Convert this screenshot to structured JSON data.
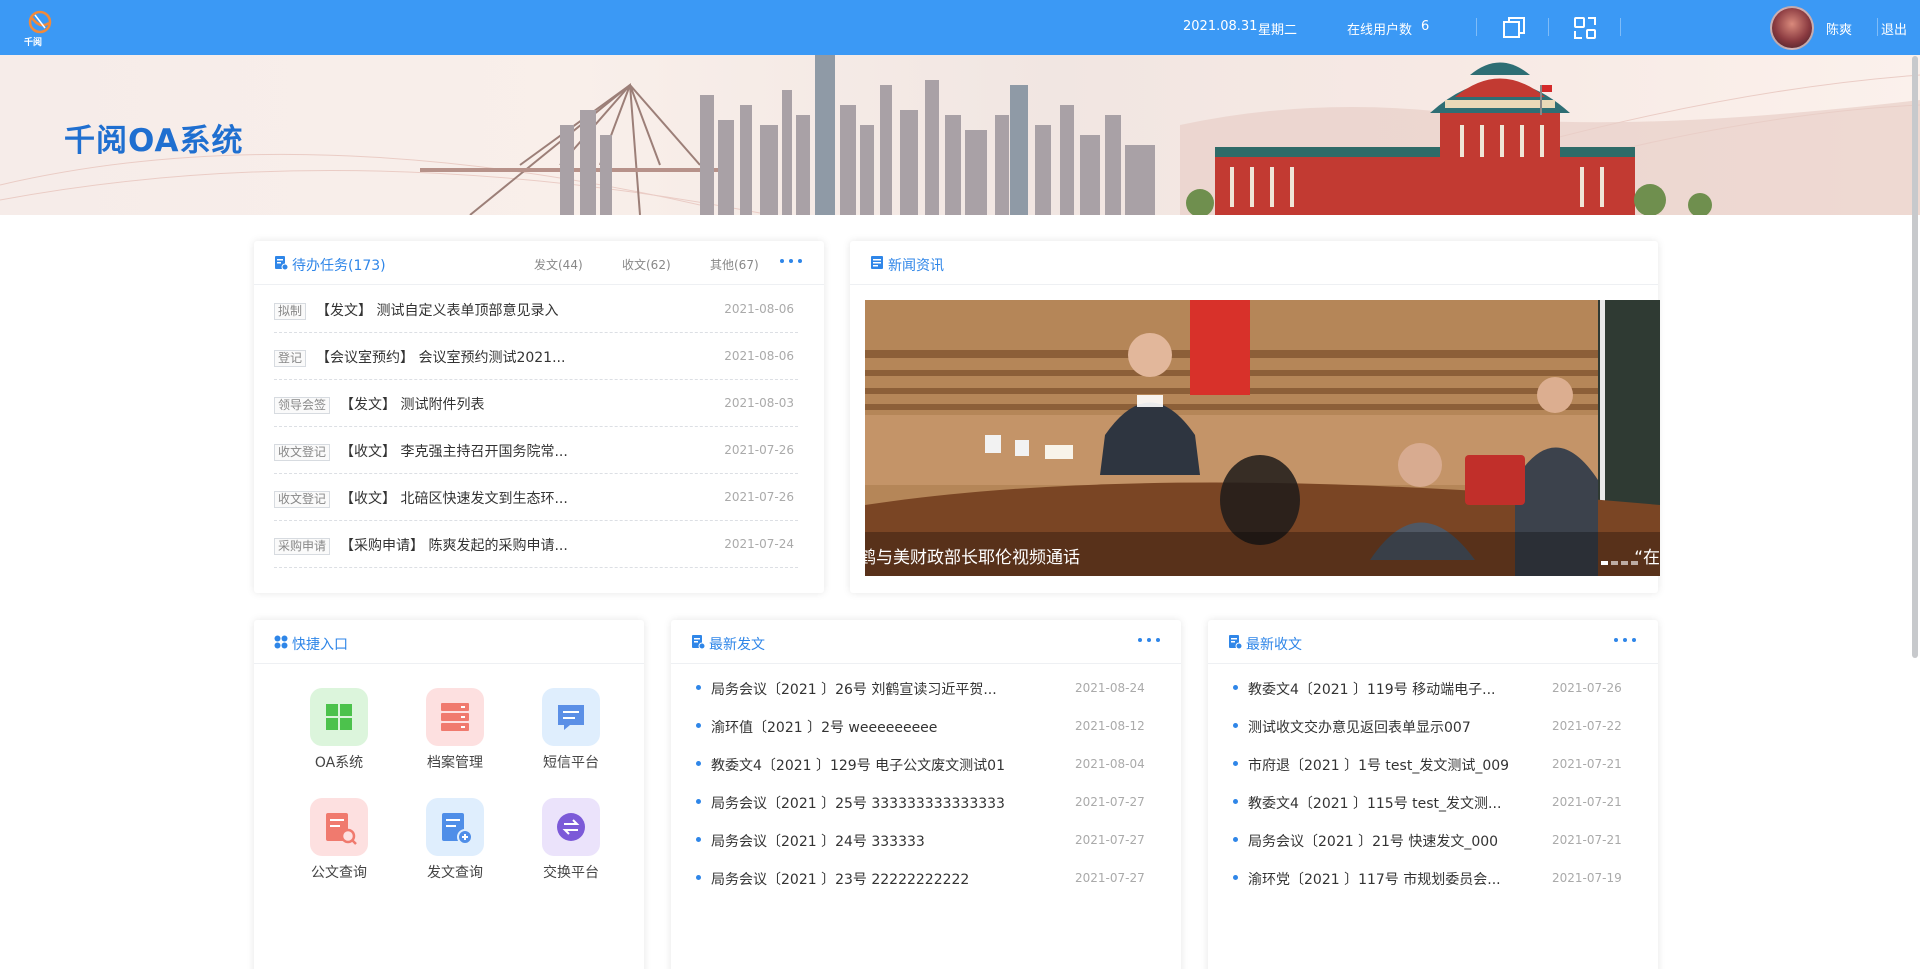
{
  "header": {
    "logo_text": "千阅",
    "date": "2021.08.31",
    "weekday": "星期二",
    "online_label": "在线用户数",
    "online_count": "6",
    "username": "陈爽",
    "logout": "退出",
    "accent": "#3b99f5"
  },
  "banner": {
    "title": "千阅OA系统"
  },
  "todo": {
    "title": "待办任务(173)",
    "filters": [
      "发文(44)",
      "收文(62)",
      "其他(67)"
    ],
    "items": [
      {
        "tag": "拟制",
        "text": "【发文】 测试自定义表单顶部意见录入",
        "date": "2021-08-06"
      },
      {
        "tag": "登记",
        "text": "【会议室预约】 会议室预约测试2021...",
        "date": "2021-08-06"
      },
      {
        "tag": "领导会签",
        "text": "【发文】 测试附件列表",
        "date": "2021-08-03"
      },
      {
        "tag": "收文登记",
        "text": "【收文】 李克强主持召开国务院常...",
        "date": "2021-07-26"
      },
      {
        "tag": "收文登记",
        "text": "【收文】 北碚区快速发文到生态环...",
        "date": "2021-07-26"
      },
      {
        "tag": "采购申请",
        "text": "【采购申请】 陈爽发起的采购申请...",
        "date": "2021-07-24"
      }
    ]
  },
  "news": {
    "title": "新闻资讯",
    "caption": "鹤与美财政部长耶伦视频通话",
    "caption_next": "“在"
  },
  "shortcuts": {
    "title": "快捷入口",
    "items": [
      {
        "label": "OA系统",
        "icon": "windows-icon",
        "bg": "#dcf5dc",
        "fg": "#4cc24c"
      },
      {
        "label": "档案管理",
        "icon": "archive-icon",
        "bg": "#fde0e0",
        "fg": "#f07a6e"
      },
      {
        "label": "短信平台",
        "icon": "sms-icon",
        "bg": "#dfeefd",
        "fg": "#5b8fe6"
      },
      {
        "label": "公文查询",
        "icon": "doc-search-icon",
        "bg": "#fde0e0",
        "fg": "#f07a6e"
      },
      {
        "label": "发文查询",
        "icon": "send-doc-icon",
        "bg": "#dfeefd",
        "fg": "#4f8ee8"
      },
      {
        "label": "交换平台",
        "icon": "exchange-icon",
        "bg": "#ebe3fb",
        "fg": "#7c5ad8"
      }
    ]
  },
  "sent": {
    "title": "最新发文",
    "items": [
      {
        "text": "局务会议〔2021 〕26号 刘鹤宣读习近平贺...",
        "date": "2021-08-24"
      },
      {
        "text": "渝环值〔2021 〕2号 weeeeeeeee",
        "date": "2021-08-12"
      },
      {
        "text": "教委文4〔2021 〕129号 电子公文废文测试01",
        "date": "2021-08-04"
      },
      {
        "text": "局务会议〔2021 〕25号 333333333333333",
        "date": "2021-07-27"
      },
      {
        "text": "局务会议〔2021 〕24号 333333",
        "date": "2021-07-27"
      },
      {
        "text": "局务会议〔2021 〕23号 22222222222",
        "date": "2021-07-27"
      }
    ]
  },
  "received": {
    "title": "最新收文",
    "items": [
      {
        "text": "教委文4〔2021 〕119号 移动端电子...",
        "date": "2021-07-26"
      },
      {
        "text": "测试收文交办意见返回表单显示007",
        "date": "2021-07-22"
      },
      {
        "text": "市府退〔2021 〕1号 test_发文测试_009",
        "date": "2021-07-21"
      },
      {
        "text": "教委文4〔2021 〕115号 test_发文测...",
        "date": "2021-07-21"
      },
      {
        "text": "局务会议〔2021 〕21号 快速发文_000",
        "date": "2021-07-21"
      },
      {
        "text": "渝环党〔2021 〕117号 市规划委员会...",
        "date": "2021-07-19"
      }
    ]
  }
}
